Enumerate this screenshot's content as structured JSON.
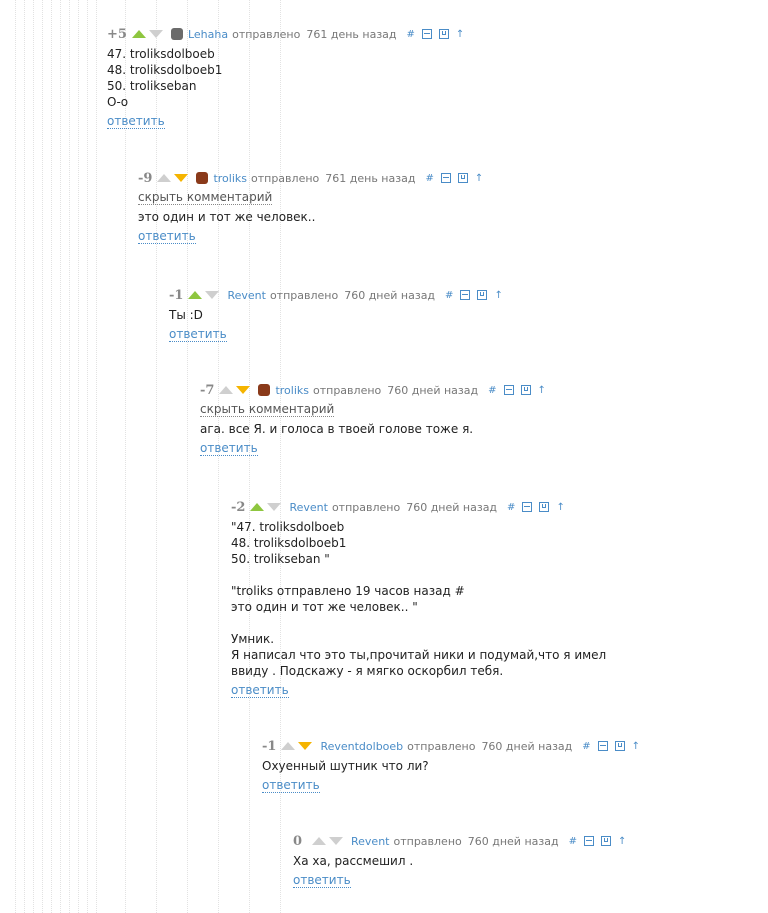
{
  "comments": [
    {
      "score": "+5",
      "up": true,
      "down": false,
      "avatar": true,
      "avatar_color": "#6b6b6b",
      "author": "Lehaha",
      "sent": "отправлено",
      "time": "761 день назад",
      "hide": "",
      "text": "47. troliksdolboeb\n48. troliksdolboeb1\n50. trolikseban\nО-о",
      "reply": "ответить"
    },
    {
      "score": "-9",
      "up": false,
      "down": true,
      "avatar": true,
      "avatar_color": "#8a3a1a",
      "author": "troliks",
      "sent": "отправлено",
      "time": "761 день назад",
      "hide": "скрыть комментарий",
      "text": "это один и тот же человек..",
      "reply": "ответить"
    },
    {
      "score": "-1",
      "up": true,
      "down": false,
      "avatar": false,
      "avatar_color": "",
      "author": "Revent",
      "sent": "отправлено",
      "time": "760 дней назад",
      "hide": "",
      "text": "Ты :D",
      "reply": "ответить"
    },
    {
      "score": "-7",
      "up": false,
      "down": true,
      "avatar": true,
      "avatar_color": "#8a3a1a",
      "author": "troliks",
      "sent": "отправлено",
      "time": "760 дней назад",
      "hide": "скрыть комментарий",
      "text": "ага. все Я. и голоса в твоей голове тоже я.",
      "reply": "ответить"
    },
    {
      "score": "-2",
      "up": true,
      "down": false,
      "avatar": false,
      "avatar_color": "",
      "author": "Revent",
      "sent": "отправлено",
      "time": "760 дней назад",
      "hide": "",
      "text": "\"47. troliksdolboeb\n48. troliksdolboeb1\n50. trolikseban \"\n\n\"troliks отправлено 19 часов назад #\nэто один и тот же человек.. \"\n\nУмник.\nЯ написал что это ты,прочитай ники и подумай,что я имел\nввиду . Подскажу - я мягко оскорбил тебя.",
      "reply": "ответить"
    },
    {
      "score": "-1",
      "up": false,
      "down": true,
      "avatar": false,
      "avatar_color": "",
      "author": "Reventdolboeb",
      "sent": "отправлено",
      "time": "760 дней назад",
      "hide": "",
      "text": "Охуенный шутник что ли?",
      "reply": "ответить"
    },
    {
      "score": "0",
      "up": false,
      "down": false,
      "avatar": false,
      "avatar_color": "",
      "author": "Revent",
      "sent": "отправлено",
      "time": "760 дней назад",
      "hide": "",
      "text": "Ха ха, рассмешил .",
      "reply": "ответить"
    }
  ],
  "icons": {
    "permalink": "#",
    "collapse": "minus-square-icon",
    "save": "save-icon",
    "parent": "↑"
  }
}
